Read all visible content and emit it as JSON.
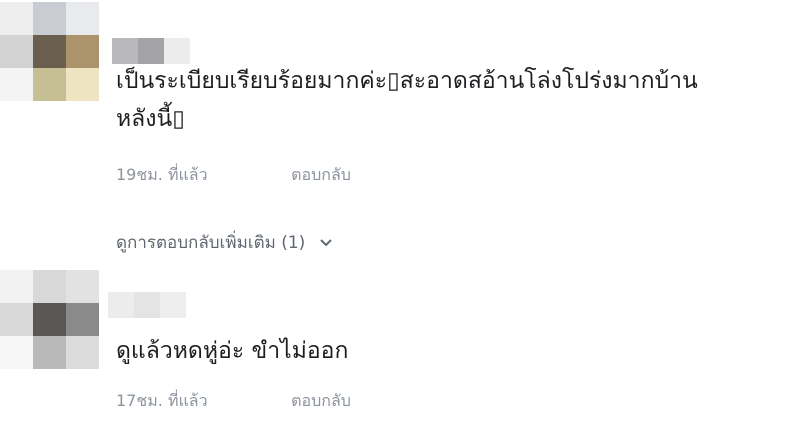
{
  "comments": [
    {
      "text_line1": "เป็นระเบียบเรียบร้อยมากค่ะ▯สะอาดสอ้านโล่งโปร่งมากบ้าน",
      "text_line2": "หลังนี้▯",
      "time": "19ชม. ที่แล้ว",
      "reply_label": "ตอบกลับ"
    },
    {
      "text_line1": "ดูแล้วหดหู่อ่ะ ขำไม่ออก",
      "time": "17ชม. ที่แล้ว",
      "reply_label": "ตอบกลับ"
    }
  ],
  "view_more_replies": {
    "label": "ดูการตอบกลับเพิ่มเติม (1)",
    "icon": "chevron-down-icon"
  },
  "colors": {
    "meta_text": "#8d949e",
    "body_text": "#1c1e21",
    "link_text": "#606770"
  }
}
